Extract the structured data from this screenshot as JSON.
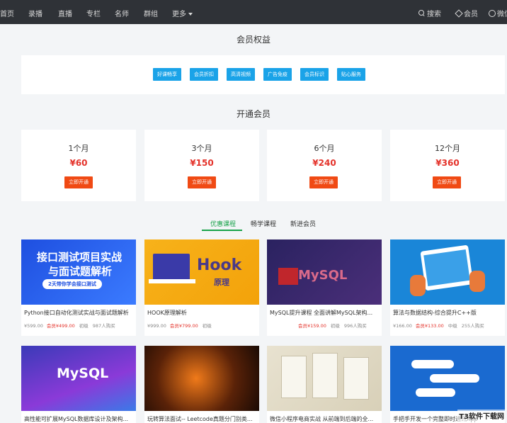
{
  "nav": {
    "items": [
      "首页",
      "录播",
      "直播",
      "专栏",
      "名师",
      "群组",
      "更多"
    ],
    "search": "搜索",
    "vip": "会员",
    "user": "微信"
  },
  "benefits": {
    "title": "会员权益",
    "items": [
      "好课畅享",
      "会员折扣",
      "高清视频",
      "广告免疫",
      "会员标识",
      "贴心服务"
    ]
  },
  "plans": {
    "title": "开通会员",
    "buy_label": "立即开通",
    "items": [
      {
        "duration": "1个月",
        "price": "¥60"
      },
      {
        "duration": "3个月",
        "price": "¥150"
      },
      {
        "duration": "6个月",
        "price": "¥240"
      },
      {
        "duration": "12个月",
        "price": "¥360"
      }
    ]
  },
  "tabs": [
    "优惠课程",
    "畅学课程",
    "新进会员"
  ],
  "courses": [
    {
      "name": "Python接口自动化测试实战与面试题解析",
      "price": "¥599.00",
      "vip": "会员¥499.00",
      "level": "初级",
      "buyers": "987人购买",
      "thumb_lines": [
        "接口测试项目实战",
        "与面试题解析"
      ],
      "thumb_sub": "2天带你学会接口测试"
    },
    {
      "name": "HOOK原理解析",
      "price": "¥999.00",
      "vip": "会员¥799.00",
      "level": "初级",
      "buyers": "",
      "thumb_lines": [
        "Hook",
        "原理"
      ],
      "thumb_sub": ""
    },
    {
      "name": "MySQL提升课程 全面讲解MySQL架构...",
      "price": "",
      "vip": "会员¥159.00",
      "level": "初级",
      "buyers": "996人购买",
      "thumb_lines": [
        "MySQL"
      ],
      "thumb_sub": ""
    },
    {
      "name": "算法与数据结构-综合提升C++版",
      "price": "¥166.00",
      "vip": "会员¥133.00",
      "level": "中级",
      "buyers": "255人购买",
      "thumb_lines": [],
      "thumb_sub": ""
    },
    {
      "name": "高性能可扩展MySQL数据库设计及架构...",
      "thumb_lines": [
        "MySQL"
      ]
    },
    {
      "name": "玩转算法面试-- Leetcode真题分门别类..."
    },
    {
      "name": "微信小程序电商实战 从前端到后端的全..."
    },
    {
      "name": "手把手开发一个完整即时通讯App"
    }
  ],
  "watermark": "T3软件下载网",
  "colors": {
    "accent": "#1aa3e8",
    "price": "#e4322a",
    "buy": "#f04a14",
    "tab_active": "#19a34a"
  }
}
